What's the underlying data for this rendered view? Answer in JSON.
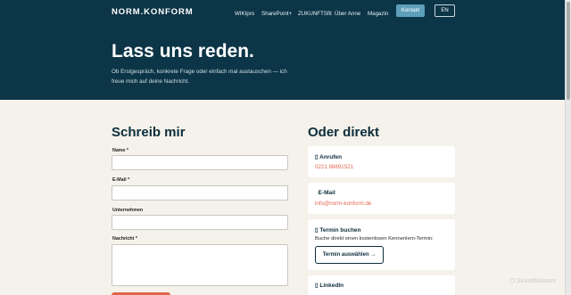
{
  "header": {
    "logo": "NORM.KONFORM",
    "nav": [
      "WIKIpro",
      "SharePoint+",
      "ZUKUNFTSfit",
      "Über Anne",
      "Magazin"
    ],
    "cta": "Kontakt",
    "lang": "EN"
  },
  "hero": {
    "title": "Lass uns reden.",
    "subtitle": "Ob Erstgespräch, konkrete Frage oder einfach mal austauschen — ich freue mich auf deine Nachricht."
  },
  "form": {
    "title": "Schreib mir",
    "fields": [
      {
        "label": "Name *",
        "value": ""
      },
      {
        "label": "E-Mail *",
        "value": ""
      },
      {
        "label": "Unternehmen",
        "value": ""
      },
      {
        "label": "Nachricht *",
        "value": ""
      }
    ]
  },
  "direct": {
    "title": "Oder direkt",
    "call": {
      "title": "Anrufen",
      "link": "0221 88891521",
      "icon": "phone-icon"
    },
    "mail": {
      "title": "E-Mail",
      "link": "info@norm-konform.de",
      "icon": "mail-icon"
    },
    "booking": {
      "title": "Termin buchen",
      "text": "Buche direkt einen kostenlosen Kennenlern-Termin:",
      "button": "Termin auswählen →",
      "icon": "calendar-icon"
    },
    "linkedin": {
      "title": "LinkedIn",
      "icon": "linkedin-icon"
    }
  },
  "watermark": "ScanMalware",
  "colors": {
    "hero_bg": "#0c3547",
    "page_bg": "#f4f2ea",
    "accent": "#e0664e",
    "button_blue": "#5ea0bb"
  }
}
